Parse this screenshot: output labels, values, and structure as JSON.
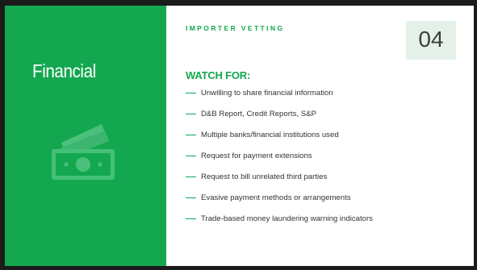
{
  "panel": {
    "title": "Financial",
    "icon": "money-icon",
    "bg_color": "#13a850"
  },
  "header": {
    "eyebrow": "IMPORTER VETTING",
    "number": "04"
  },
  "section": {
    "heading": "WATCH FOR:",
    "items": [
      "Unwilling to share financial information",
      "D&B Report, Credit Reports, S&P",
      "Multiple banks/financial institutions used",
      "Request for payment extensions",
      "Request to bill unrelated third parties",
      "Evasive payment methods or arrangements",
      "Trade-based money laundering warning indicators"
    ]
  },
  "colors": {
    "accent": "#13a850",
    "number_bg": "#e4f1e9",
    "frame": "#1b1b1b"
  }
}
